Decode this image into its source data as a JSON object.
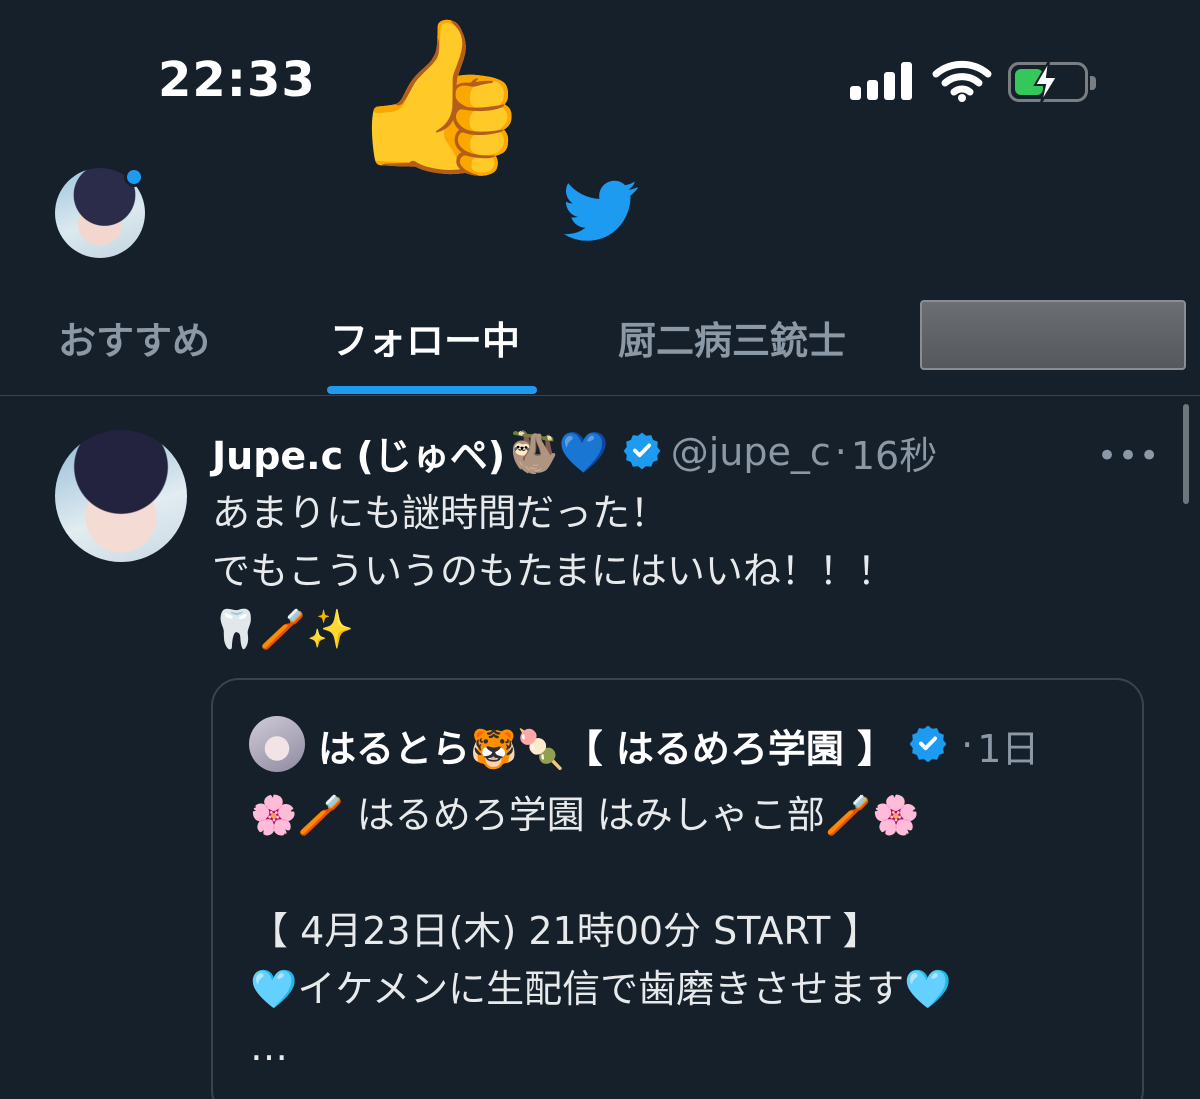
{
  "status_bar": {
    "time": "22:33",
    "signal_icon": "cellular-signal-icon",
    "wifi_icon": "wifi-icon",
    "battery_icon": "battery-charging-icon"
  },
  "overlay_emoji": "👍",
  "header": {
    "logo_icon": "twitter-bird-icon",
    "accent_color": "#1d9bf0"
  },
  "tabs": [
    {
      "label": "おすすめ",
      "active": false
    },
    {
      "label": "フォロー中",
      "active": true
    },
    {
      "label": "厨二病三銃士",
      "active": false
    }
  ],
  "tweet": {
    "name": "Jupe.c (じゅペ)",
    "name_emoji": "🦥💙",
    "handle": "@jupe_c",
    "separator": "·",
    "time": "16秒",
    "more": "•••",
    "lines": [
      "あまりにも謎時間だった！",
      "でもこういうのもたまにはいいね！！！",
      "🦷🪥✨"
    ]
  },
  "quote": {
    "name": "はるとら🐯🍡【 はるめろ学園 】",
    "separator": "·",
    "time": "1日",
    "lines": [
      "🌸🪥 はるめろ学園 はみしゃこ部🪥🌸",
      "",
      "【 4月23日(木) 21時00分 START 】",
      "🩵イケメンに生配信で歯磨きさせます🩵",
      "…"
    ]
  }
}
